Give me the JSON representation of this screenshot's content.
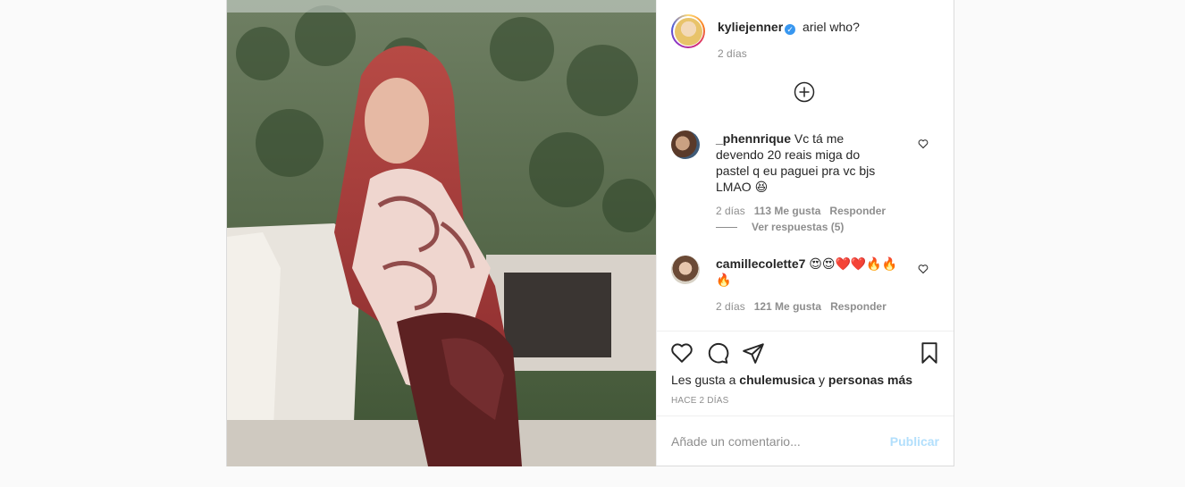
{
  "post": {
    "owner": {
      "username": "kyliejenner",
      "verified_icon": "verified-badge-icon",
      "caption": "ariel who?",
      "caption_time": "2 días"
    },
    "load_more_icon": "plus-circle-icon",
    "comments": [
      {
        "username": "_phennrique",
        "text": "Vc tá me devendo 20 reais miga do pastel q eu paguei pra vc bjs LMAO 😆",
        "time": "2 días",
        "likes": "113 Me gusta",
        "reply": "Responder",
        "view_replies": "Ver respuestas (5)"
      },
      {
        "username": "camillecolette7",
        "text": "😍😍❤️❤️🔥🔥🔥",
        "time": "2 días",
        "likes": "121 Me gusta",
        "reply": "Responder"
      }
    ],
    "likes_prefix": "Les gusta a",
    "likes_user": "chulemusica",
    "likes_and": "y",
    "likes_others": "personas más",
    "timestamp": "HACE 2 DÍAS",
    "comment_placeholder": "Añade un comentario...",
    "publish_label": "Publicar"
  },
  "colors": {
    "accent_blue": "#3897f0",
    "publish_disabled": "#b2dffc",
    "secondary_text": "#8e8e8e"
  }
}
